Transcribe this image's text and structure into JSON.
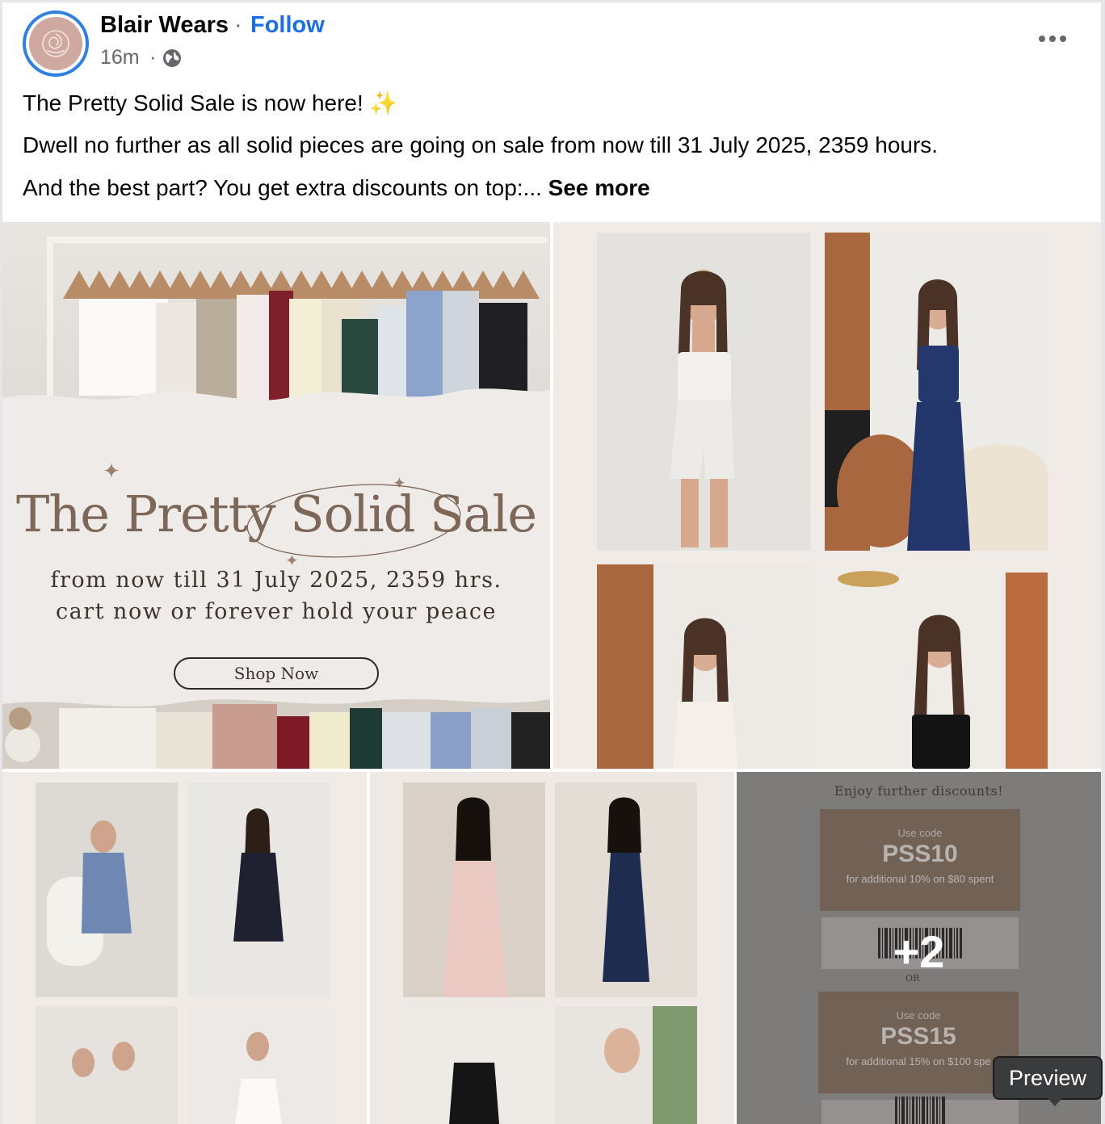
{
  "post": {
    "author": "Blair Wears",
    "separator": "·",
    "follow_label": "Follow",
    "time": "16m",
    "time_separator": "·",
    "audience_icon": "globe-icon",
    "more_icon": "more-options-icon",
    "lines": [
      "The Pretty Solid Sale is now here! ",
      "Dwell no further as all solid pieces are going on sale from now till 31 July 2025, 2359 hours.",
      "And the best part? You get extra discounts on top:... "
    ],
    "sparkle_emoji": "✨",
    "see_more_label": "See more"
  },
  "banner": {
    "title": "The Pretty Solid Sale",
    "subtitle_1": "from now till 31 July 2025, 2359 hrs.",
    "subtitle_2": "cart now or forever hold your peace",
    "button_label": "Shop Now"
  },
  "discounts": {
    "heading": "Enjoy further discounts!",
    "coupons": [
      {
        "use_label": "Use code",
        "code": "PSS10",
        "terms": "for additional 10% on $80 spent"
      },
      {
        "use_label": "Use code",
        "code": "PSS15",
        "terms": "for additional 15% on $100 spe"
      }
    ],
    "or_label": "OR",
    "more_count": "+2"
  },
  "tooltip": {
    "label": "Preview"
  },
  "colors": {
    "accent": "#1b6ee8",
    "avatar_ring": "#2f7fe3",
    "banner_text": "#7c6759",
    "coupon": "#8a705e"
  }
}
